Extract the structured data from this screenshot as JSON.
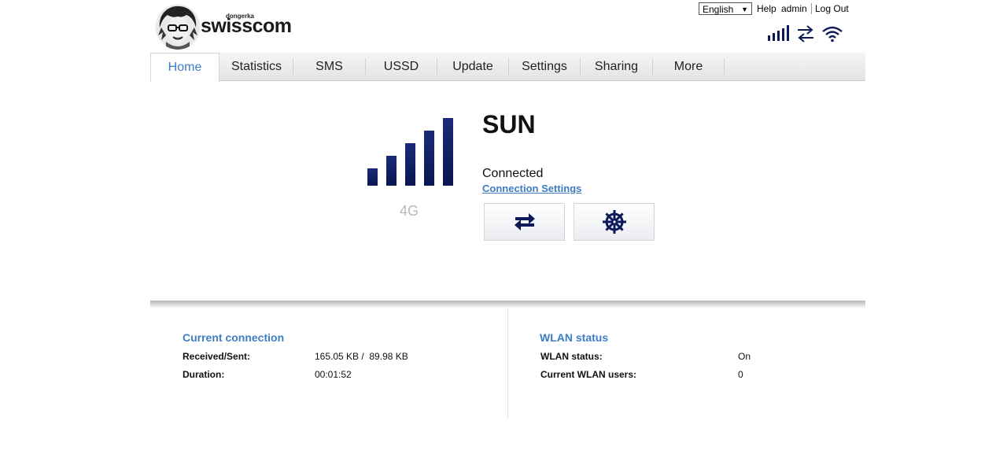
{
  "header": {
    "brand_name": "swisscom",
    "brand_small": "dongerka",
    "language": "English",
    "help_label": "Help",
    "user_label": "admin",
    "logout_label": "Log Out"
  },
  "nav": {
    "tabs": [
      "Home",
      "Statistics",
      "SMS",
      "USSD",
      "Update",
      "Settings",
      "Sharing",
      "More"
    ],
    "active": "Home"
  },
  "signal": {
    "level": 5,
    "max": 5,
    "network_type": "4G",
    "bar_color": "#0c1a5c"
  },
  "connection": {
    "operator": "SUN",
    "status": "Connected",
    "settings_link": "Connection Settings",
    "connect_icon": "transfer-arrows-icon",
    "roaming_icon": "ship-wheel-icon"
  },
  "current_connection": {
    "title": "Current connection",
    "rows": [
      {
        "label": "Received/Sent:",
        "value": "165.05 KB /  89.98 KB"
      },
      {
        "label": "Duration:",
        "value": "00:01:52"
      }
    ]
  },
  "wlan_status": {
    "title": "WLAN status",
    "rows": [
      {
        "label": "WLAN status:",
        "value": "On"
      },
      {
        "label": "Current WLAN users:",
        "value": "0"
      }
    ]
  },
  "colors": {
    "accent": "#3d7dc4",
    "icon_navy": "#0c1a5c"
  }
}
